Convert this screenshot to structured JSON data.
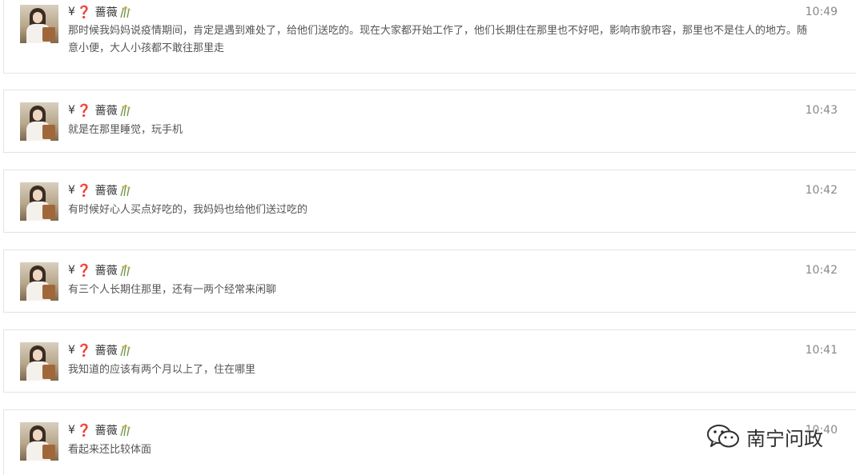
{
  "messages": [
    {
      "user": {
        "prefix": "¥",
        "badge": "❓",
        "name": "蔷薇",
        "name_icon": "plant-icon"
      },
      "time": "10:49",
      "text": "那时候我妈妈说疫情期间，肯定是遇到难处了，给他们送吃的。现在大家都开始工作了，他们长期住在那里也不好吧，影响市貌市容，那里也不是住人的地方。随意小便，大人小孩都不敢往那里走"
    },
    {
      "user": {
        "prefix": "¥",
        "badge": "❓",
        "name": "蔷薇",
        "name_icon": "plant-icon"
      },
      "time": "10:43",
      "text": "就是在那里睡觉，玩手机"
    },
    {
      "user": {
        "prefix": "¥",
        "badge": "❓",
        "name": "蔷薇",
        "name_icon": "plant-icon"
      },
      "time": "10:42",
      "text": "有时候好心人买点好吃的，我妈妈也给他们送过吃的"
    },
    {
      "user": {
        "prefix": "¥",
        "badge": "❓",
        "name": "蔷薇",
        "name_icon": "plant-icon"
      },
      "time": "10:42",
      "text": "有三个人长期住那里，还有一两个经常来闲聊"
    },
    {
      "user": {
        "prefix": "¥",
        "badge": "❓",
        "name": "蔷薇",
        "name_icon": "plant-icon"
      },
      "time": "10:41",
      "text": "我知道的应该有两个月以上了，住在哪里"
    },
    {
      "user": {
        "prefix": "¥",
        "badge": "❓",
        "name": "蔷薇",
        "name_icon": "plant-icon"
      },
      "time": "10:40",
      "text": "看起来还比较体面"
    }
  ],
  "watermark": {
    "icon": "wechat-icon",
    "text": "南宁问政"
  },
  "colors": {
    "badge": "#d0312d",
    "time": "#888888",
    "text": "#555555",
    "border": "#e3e3e3"
  }
}
